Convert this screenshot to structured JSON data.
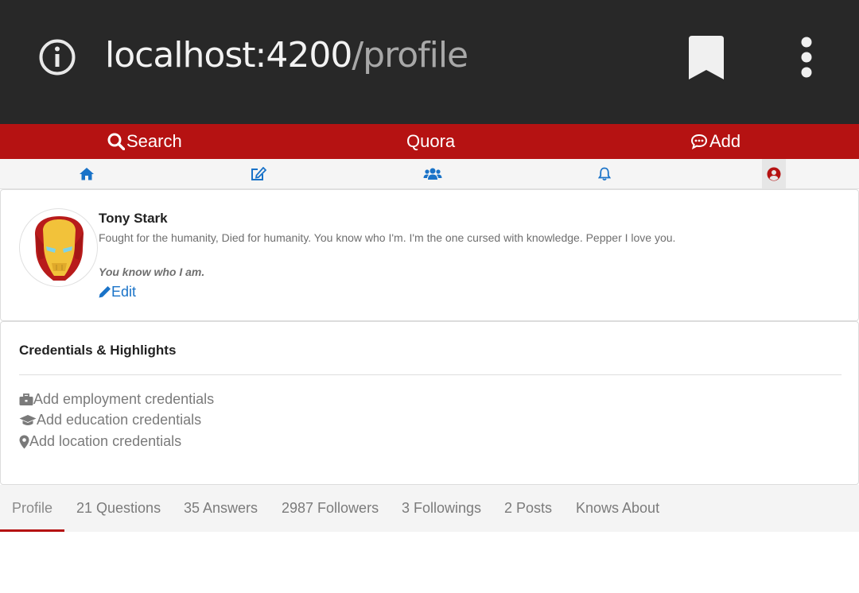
{
  "browser": {
    "url_host": "localhost:4200",
    "url_path": "/profile",
    "info_icon": "info-icon",
    "bookmark_icon": "bookmark-icon",
    "menu_icon": "kebab-menu-icon"
  },
  "topnav": {
    "search_label": "Search",
    "brand": "Quora",
    "add_label": "Add",
    "background": "#b51212"
  },
  "iconnav": {
    "items": [
      "home-icon",
      "edit-icon",
      "users-icon",
      "bell-icon",
      "user-circle-icon"
    ],
    "accent": "#1a73c8",
    "active_color": "#b51212"
  },
  "profile": {
    "name": "Tony Stark",
    "bio": "Fought for the humanity, Died for humanity. You know who I'm. I'm the one cursed with knowledge. Pepper I love you.",
    "tagline": "You know who I am.",
    "edit_label": "Edit"
  },
  "credentials": {
    "title": "Credentials & Highlights",
    "items": [
      {
        "icon": "briefcase-icon",
        "label": "Add employment credentials"
      },
      {
        "icon": "graduation-cap-icon",
        "label": "Add education credentials"
      },
      {
        "icon": "map-marker-icon",
        "label": "Add location credentials"
      }
    ]
  },
  "tabs": [
    {
      "label": "Profile",
      "active": true
    },
    {
      "label": "21 Questions"
    },
    {
      "label": "35 Answers"
    },
    {
      "label": "2987 Followers"
    },
    {
      "label": "3 Followings"
    },
    {
      "label": "2 Posts"
    },
    {
      "label": "Knows About"
    }
  ]
}
